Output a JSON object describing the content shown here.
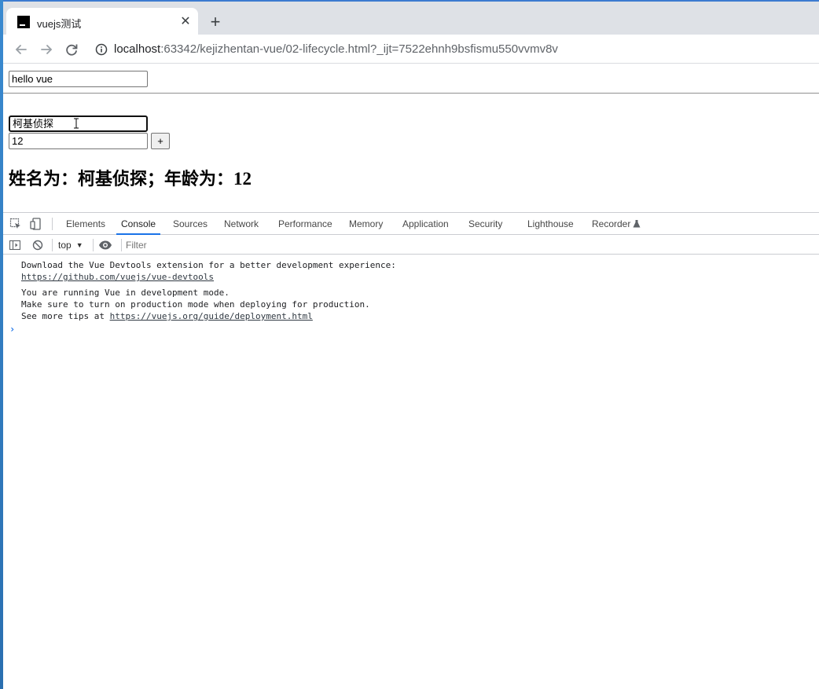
{
  "browser": {
    "tab_title": "vuejs测试",
    "url_host": "localhost",
    "url_rest": ":63342/kejizhentan-vue/02-lifecycle.html?_ijt=7522ehnh9bsfismu550vvmv8v"
  },
  "page": {
    "message_value": "hello vue",
    "name_value": "柯基侦探",
    "age_value": "12",
    "plus_label": "+",
    "summary_prefix": "姓名为：柯基侦探；年龄为：",
    "summary_age": "12"
  },
  "devtools": {
    "tabs": [
      "Elements",
      "Console",
      "Sources",
      "Network",
      "Performance",
      "Memory",
      "Application",
      "Security",
      "Lighthouse",
      "Recorder"
    ],
    "active_tab": "Console",
    "context": "top",
    "filter_placeholder": "Filter",
    "console": {
      "line1": "Download the Vue Devtools extension for a better development experience:",
      "link1": "https://github.com/vuejs/vue-devtools",
      "line2": "You are running Vue in development mode.",
      "line3": "Make sure to turn on production mode when deploying for production.",
      "line4_prefix": "See more tips at ",
      "link2": "https://vuejs.org/guide/deployment.html"
    }
  }
}
